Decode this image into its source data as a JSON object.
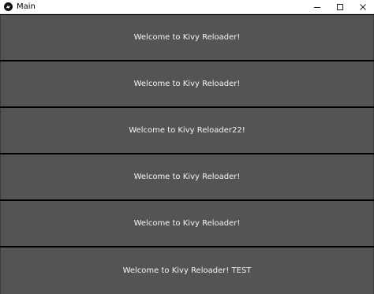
{
  "window": {
    "title": "Main"
  },
  "panels": [
    {
      "label": "Welcome to Kivy Reloader!"
    },
    {
      "label": "Welcome to Kivy Reloader!"
    },
    {
      "label": "Welcome to Kivy Reloader22!"
    },
    {
      "label": "Welcome to Kivy Reloader!"
    },
    {
      "label": "Welcome to Kivy Reloader!"
    },
    {
      "label": "Welcome to Kivy Reloader! TEST"
    }
  ],
  "colors": {
    "panel_bg": "#545454",
    "panel_text": "#f4f4f4",
    "divider": "#000000",
    "titlebar_bg": "#ffffff"
  },
  "icons": {
    "app": "kivy-app-icon",
    "minimize": "minimize-icon",
    "maximize": "maximize-icon",
    "close": "close-icon"
  }
}
